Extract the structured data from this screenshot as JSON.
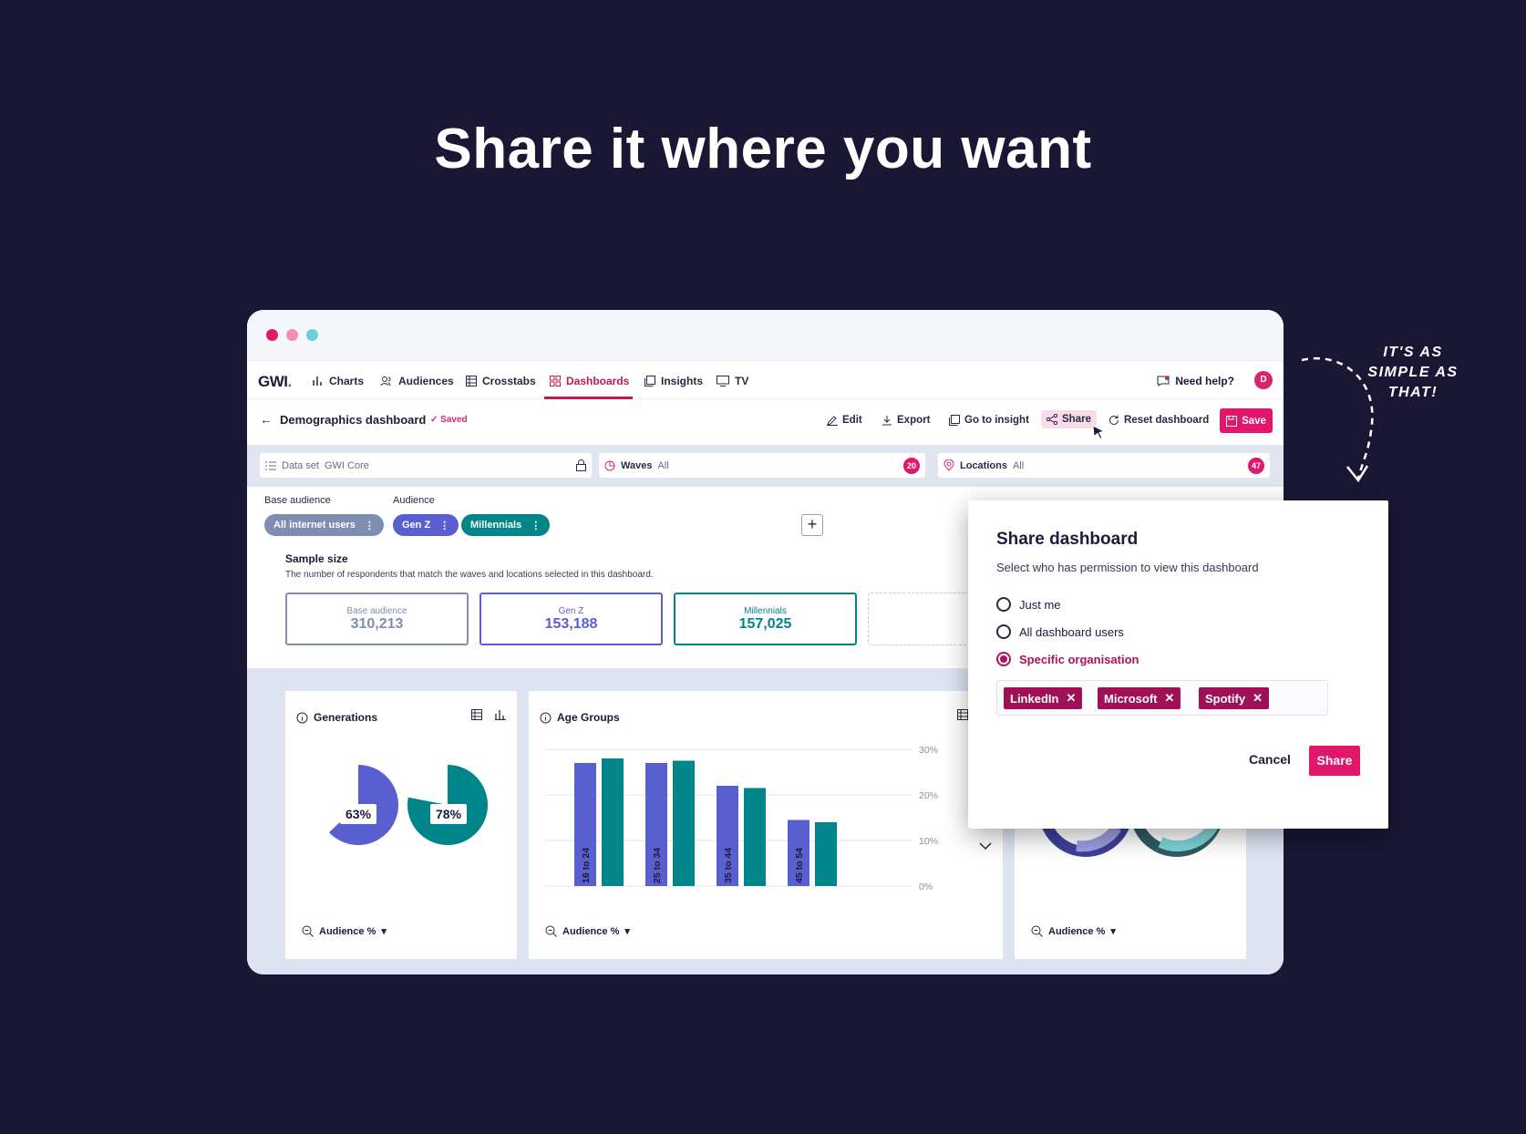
{
  "hero": {
    "title": "Share it where you want"
  },
  "annotation": {
    "line1": "IT'S AS",
    "line2": "SIMPLE AS",
    "line3": "THAT!"
  },
  "window_dots": [
    "#e2176c",
    "#f48bbd",
    "#6ccfe0"
  ],
  "nav": {
    "logo": "GWI",
    "items": [
      {
        "label": "Charts",
        "icon": "bar-chart-icon"
      },
      {
        "label": "Audiences",
        "icon": "users-icon"
      },
      {
        "label": "Crosstabs",
        "icon": "table-icon"
      },
      {
        "label": "Dashboards",
        "icon": "dashboard-icon",
        "active": true
      },
      {
        "label": "Insights",
        "icon": "insights-icon"
      },
      {
        "label": "TV",
        "icon": "tv-icon"
      }
    ],
    "help": "Need help?",
    "avatar": "D"
  },
  "toolbar": {
    "title": "Demographics dashboard",
    "saved": "Saved",
    "edit": "Edit",
    "export": "Export",
    "go_to_insight": "Go to insight",
    "share": "Share",
    "reset": "Reset dashboard",
    "save": "Save"
  },
  "filters": {
    "dataset_label": "Data set",
    "dataset_value": "GWI Core",
    "waves_label": "Waves",
    "waves_value": "All",
    "waves_count": "20",
    "locations_label": "Locations",
    "locations_value": "All",
    "locations_count": "47"
  },
  "audiences": {
    "base_label": "Base audience",
    "audience_label": "Audience",
    "base_pill": "All internet users",
    "pills": [
      "Gen Z",
      "Millennials"
    ]
  },
  "sample": {
    "title": "Sample size",
    "desc": "The number of respondents that match the waves and locations selected in this dashboard.",
    "boxes": [
      {
        "label": "Base audience",
        "value": "310,213"
      },
      {
        "label": "Gen Z",
        "value": "153,188"
      },
      {
        "label": "Millennials",
        "value": "157,025"
      }
    ]
  },
  "cards": {
    "generations": {
      "title": "Generations",
      "footer": "Audience %"
    },
    "age_groups": {
      "title": "Age Groups",
      "footer": "Audience %"
    },
    "third": {
      "footer": "Audience %"
    }
  },
  "colors": {
    "genz": "#5a5fcf",
    "millennials": "#00858a",
    "brand": "#e2176c",
    "tag": "#a01056"
  },
  "chart_data": [
    {
      "type": "pie",
      "title": "Generations",
      "series": [
        {
          "name": "Gen Z",
          "value": 63,
          "label": "63%"
        },
        {
          "name": "Millennials",
          "value": 78,
          "label": "78%"
        }
      ]
    },
    {
      "type": "bar",
      "title": "Age Groups",
      "categories": [
        "16 to 24",
        "25 to 34",
        "35 to 44",
        "45 to 54"
      ],
      "series": [
        {
          "name": "Gen Z",
          "values": [
            27,
            27,
            22,
            14.5
          ]
        },
        {
          "name": "Millennials",
          "values": [
            28,
            27.5,
            21.5,
            14
          ]
        }
      ],
      "ylim": [
        0,
        30
      ],
      "yticks": [
        "0%",
        "10%",
        "20%",
        "30%"
      ],
      "grid": true
    }
  ],
  "modal": {
    "title": "Share dashboard",
    "subtitle": "Select who has permission to view this dashboard",
    "options": [
      "Just me",
      "All dashboard users",
      "Specific organisation"
    ],
    "selected": "Specific organisation",
    "tags": [
      "LinkedIn",
      "Microsoft",
      "Spotify"
    ],
    "cancel": "Cancel",
    "share": "Share"
  }
}
